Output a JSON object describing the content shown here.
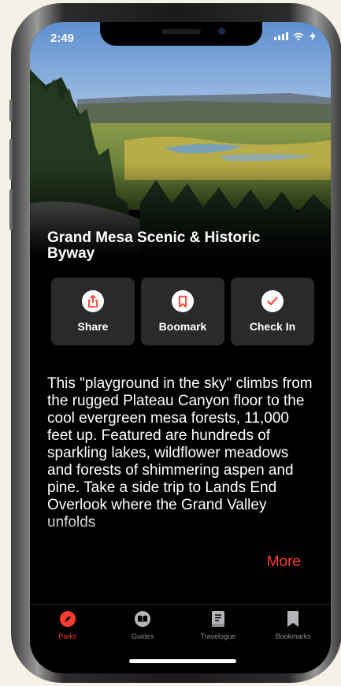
{
  "status": {
    "time": "2:49"
  },
  "hero": {
    "image": "mountain-mesa-forest-landscape"
  },
  "title": "Grand Mesa Scenic & Historic Byway",
  "actions": [
    {
      "label": "Share",
      "icon": "share-icon"
    },
    {
      "label": "Boomark",
      "icon": "bookmark-icon"
    },
    {
      "label": "Check In",
      "icon": "checkmark-icon"
    }
  ],
  "description": "This \"playground in the sky\" climbs from the rugged Plateau Canyon floor to the cool evergreen mesa forests, 11,000 feet up. Featured are hundreds of sparkling lakes, wildflower meadows and forests of shimmering aspen and pine. Take a side trip to Lands End Overlook where the Grand Valley unfolds",
  "more_label": "More",
  "tabs": [
    {
      "label": "Parks",
      "icon": "compass-icon",
      "active": true
    },
    {
      "label": "Guides",
      "icon": "book-icon",
      "active": false
    },
    {
      "label": "Travelogue",
      "icon": "notebook-icon",
      "active": false
    },
    {
      "label": "Bookmarks",
      "icon": "bookmark-icon",
      "active": false
    }
  ],
  "colors": {
    "accent": "#ff3b30",
    "card": "#2a2a2a",
    "background": "#000000"
  }
}
